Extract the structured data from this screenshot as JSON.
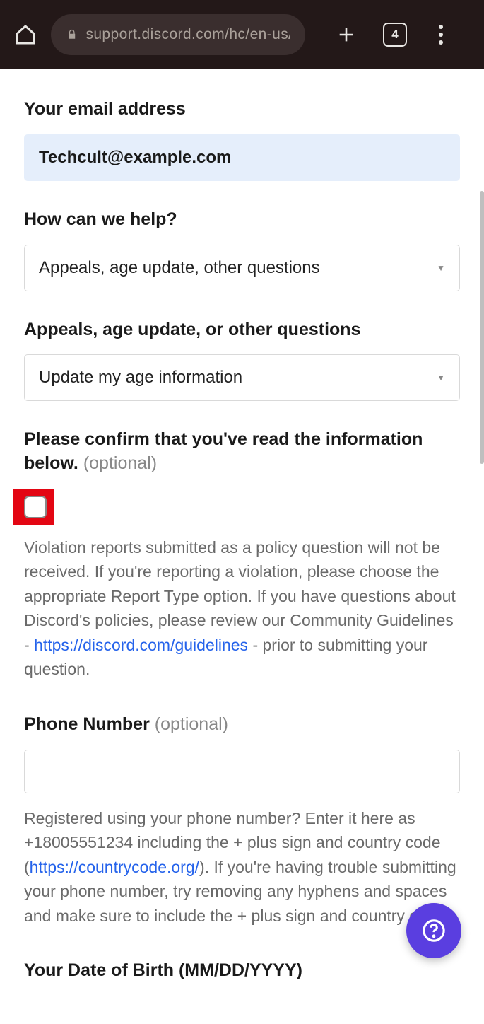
{
  "browser": {
    "url": "support.discord.com/hc/en-us/requ",
    "tab_count": "4"
  },
  "form": {
    "email": {
      "label": "Your email address",
      "value": "Techcult@example.com"
    },
    "help": {
      "label": "How can we help?",
      "value": "Appeals, age update, other questions"
    },
    "subtype": {
      "label": "Appeals, age update, or other questions",
      "value": "Update my age information"
    },
    "confirm": {
      "label_main": "Please confirm that you've read the information below. ",
      "label_optional": "(optional)",
      "help_pre": "Violation reports submitted as a policy question will not be received. If you're reporting a violation, please choose the appropriate Report Type option. If you have questions about Discord's policies, please review our Community Guidelines - ",
      "help_link": "https://discord.com/guidelines",
      "help_post": " - prior to submitting your question."
    },
    "phone": {
      "label_main": "Phone Number ",
      "label_optional": "(optional)",
      "help_pre": "Registered using your phone number? Enter it here as +18005551234 including the + plus sign and country code (",
      "help_link": "https://countrycode.org/",
      "help_post": "). If you're having trouble submitting your phone number, try removing any hyphens and spaces and make sure to include the + plus sign and country code."
    },
    "dob": {
      "label": "Your Date of Birth (MM/DD/YYYY)"
    }
  }
}
